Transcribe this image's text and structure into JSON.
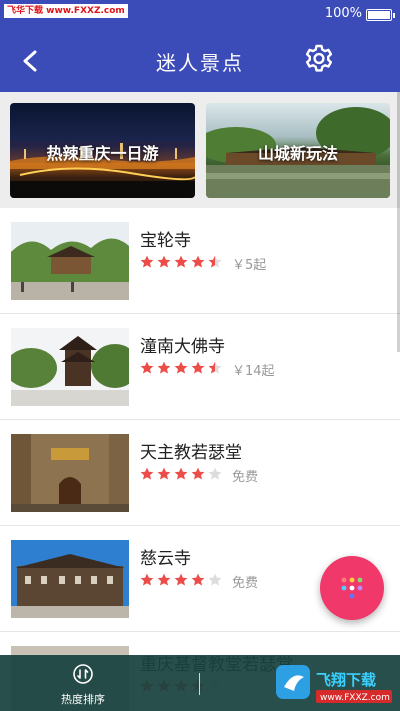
{
  "status_bar": {
    "site_logo": "飞华下载 www.FXXZ.com",
    "battery_text": "100%"
  },
  "nav": {
    "title": "迷人景点"
  },
  "banners": [
    {
      "label": "热辣重庆一日游"
    },
    {
      "label": "山城新玩法"
    }
  ],
  "attractions": [
    {
      "name": "宝轮寺",
      "rating": 4.5,
      "price": "￥5起"
    },
    {
      "name": "潼南大佛寺",
      "rating": 4.5,
      "price": "￥14起"
    },
    {
      "name": "天主教若瑟堂",
      "rating": 4,
      "price": "免费"
    },
    {
      "name": "慈云寺",
      "rating": 4,
      "price": "免费"
    },
    {
      "name": "重庆基督教堂若瑟堂",
      "rating": 4,
      "price": ""
    }
  ],
  "bottom_bar": {
    "sort_label": "热度排序"
  },
  "watermark": {
    "text_main": "飞翔下载",
    "text_url": "www.FXXZ.com"
  },
  "colors": {
    "primary": "#3b4bb8",
    "star": "#ec4d49",
    "star_empty": "#dcdcdc",
    "fab": "#f0386b",
    "bottom_bar": "#18423e"
  },
  "fab_icon": "dots-grid-icon"
}
